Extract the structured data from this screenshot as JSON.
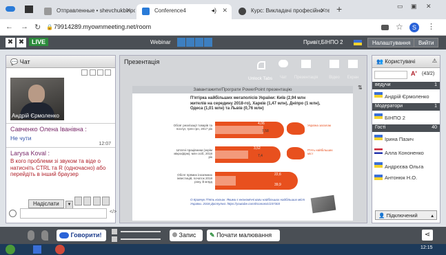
{
  "browser": {
    "tabs": [
      {
        "label": "Отправленные • shevchukbinpo"
      },
      {
        "label": "Conference4"
      },
      {
        "label": "Курс: Викладачі професійно-те"
      }
    ],
    "url": "79914289.myownmeeting.net/room",
    "profile_initial": "S"
  },
  "app": {
    "logo": "LIVE",
    "mode": "Webinar",
    "greeting": "Привіт,БІНПО 2",
    "settings_label": "Налаштування",
    "exit_label": "Вийти"
  },
  "chat": {
    "title": "Чат",
    "video_name": "Андрій Єрмоленко",
    "messages": [
      {
        "author": "Савченко Олена Іванівна :",
        "text": "Не чути",
        "time": "12:07"
      },
      {
        "author": "Larysa Koval :",
        "text": "В кого проблеми зі звуком та віде о натисніть CTRL та R (одночасно) або перейдіть в інший браузер"
      }
    ],
    "send_label": "Надіслати"
  },
  "presentation": {
    "title": "Презентація",
    "unlock_label": "Unlock Tabs",
    "tools": [
      "Чат",
      "Презентація",
      "Відео",
      "Екран"
    ],
    "upload_label": "Завантажити/Програти PowerPoint презентацію",
    "slide": {
      "heading": "П'ятірка найбільших мегаполісів України: Київ (2,94 млн жителів на середину 2018-го), Харків (1,47 млн), Дніпро (1 млн), Одеса (1,01 млн) та Львів (0,76 млн)",
      "rows": [
        {
          "label": "Обсяг реалізації товарів та послуг, трлн грн, 2017 рік",
          "values": [
            "4,06",
            "7,58"
          ],
          "note": "Україна загалом"
        },
        {
          "label": "Штатні працівники (окрім мікрофірм), млн осіб, 2018 рік",
          "values": [
            "3,52",
            "7,4"
          ],
          "note": "П'ять найбільших міст"
        },
        {
          "label": "Обсяг прямих іноземних інвестицій, початок 2018 року, $ млрд",
          "values": [
            "22,6",
            "39,9"
          ],
          "note": ""
        }
      ],
      "source": "О.Кравчук П'ять кольок. Якими є економічні ваги найбільших найбільших міст України. 2018 Доступно: https://youtube.com/Economic/237303"
    }
  },
  "users": {
    "title": "Користувачі",
    "count": "(43/2)",
    "sections": [
      {
        "name": "ведучи",
        "count": "1",
        "members": [
          "Андрій Єрмоленко"
        ]
      },
      {
        "name": "Модератори",
        "count": "1",
        "members": [
          "БІНПО 2"
        ]
      },
      {
        "name": "Гості",
        "count": "40",
        "members": [
          "Ірина Пазич",
          "Алла Кононенко",
          "Андрєєва Ольга",
          "Антонюк Н.О."
        ]
      }
    ],
    "connected_label": "Підключений"
  },
  "bottom": {
    "speak_label": "Говорити!",
    "record_label": "Запис",
    "draw_label": "Почати малювання"
  },
  "taskbar": {
    "time": "12:15"
  }
}
